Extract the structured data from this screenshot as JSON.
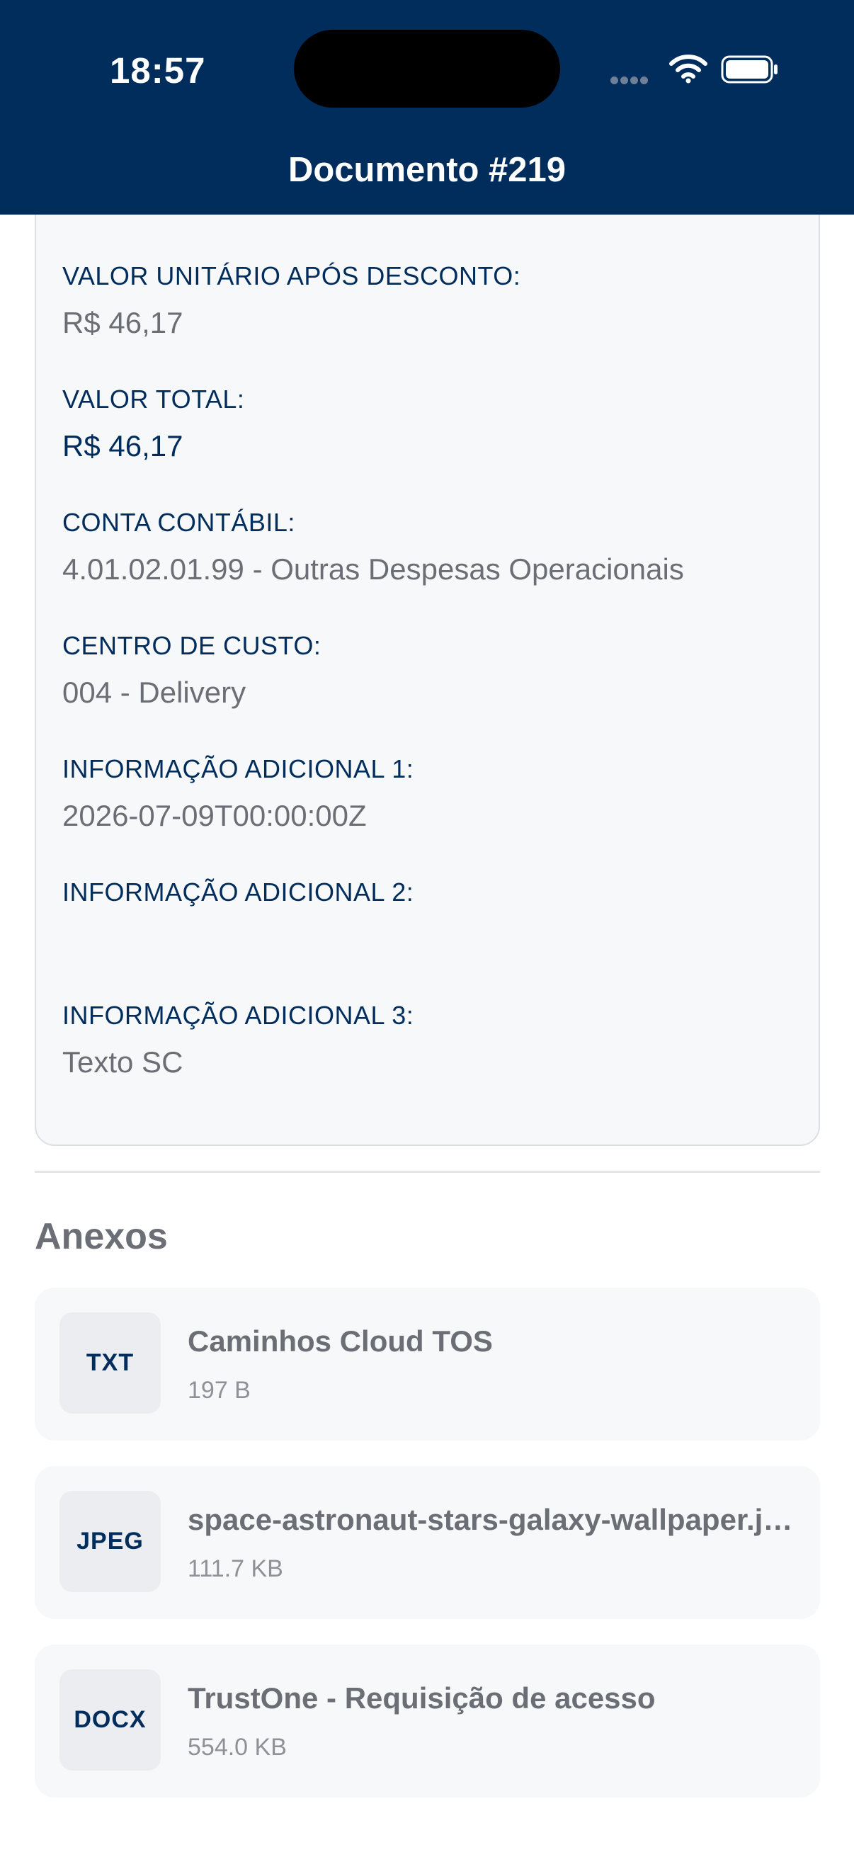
{
  "status_bar": {
    "time": "18:57"
  },
  "header": {
    "title": "Documento #219"
  },
  "details": [
    {
      "label": "VALOR UNITÁRIO APÓS DESCONTO:",
      "value": "R$ 46,17"
    },
    {
      "label": "VALOR TOTAL:",
      "value": "R$ 46,17"
    },
    {
      "label": "CONTA CONTÁBIL:",
      "value": "4.01.02.01.99 - Outras Despesas Operacionais"
    },
    {
      "label": "CENTRO DE CUSTO:",
      "value": "004 - Delivery"
    },
    {
      "label": "INFORMAÇÃO ADICIONAL 1:",
      "value": "2026-07-09T00:00:00Z"
    },
    {
      "label": "INFORMAÇÃO ADICIONAL 2:",
      "value": ""
    },
    {
      "label": "INFORMAÇÃO ADICIONAL 3:",
      "value": "Texto SC"
    }
  ],
  "attachments": {
    "title": "Anexos",
    "items": [
      {
        "type": "TXT",
        "name": "Caminhos Cloud TOS",
        "size": "197 B"
      },
      {
        "type": "JPEG",
        "name": "space-astronaut-stars-galaxy-wallpaper.jpg",
        "size": "111.7 KB"
      },
      {
        "type": "DOCX",
        "name": "TrustOne - Requisição de acesso",
        "size": "554.0 KB"
      }
    ]
  },
  "icons": [
    "cellular-dots-icon",
    "wifi-icon",
    "battery-icon"
  ],
  "colors": {
    "header_bg": "#002d5c",
    "label": "#002d5c",
    "value": "#6b6f75"
  }
}
